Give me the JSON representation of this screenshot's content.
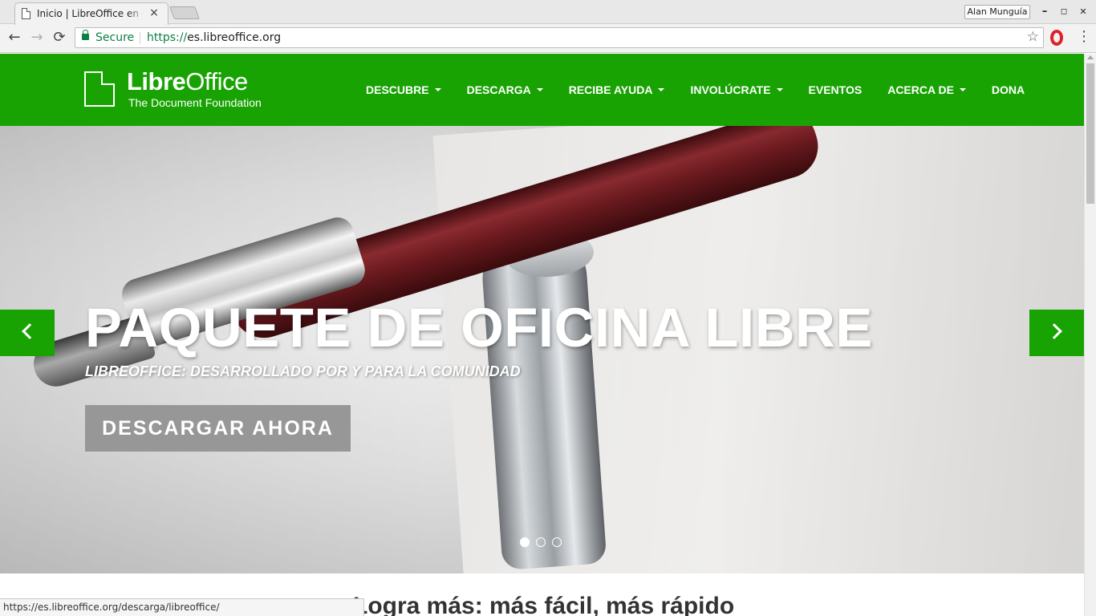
{
  "browser": {
    "tab_title": "Inicio | LibreOffice en español",
    "tab_close": "×",
    "profile_name": "Alan Munguía",
    "window_buttons": {
      "minimize": "–",
      "maximize": "◻",
      "close": "✕"
    },
    "nav": {
      "back": "←",
      "forward": "→",
      "reload": "⟳"
    },
    "security_label": "Secure",
    "url_scheme": "https://",
    "url_host": "es.libreoffice.org",
    "bookmark_icon": "☆",
    "menu_icon": "⋮",
    "status_url": "https://es.libreoffice.org/descarga/libreoffice/"
  },
  "site": {
    "logo": {
      "name_bold": "Libre",
      "name_regular": "Office",
      "tagline": "The Document Foundation"
    },
    "nav": [
      {
        "label": "DESCUBRE",
        "dropdown": true
      },
      {
        "label": "DESCARGA",
        "dropdown": true
      },
      {
        "label": "RECIBE AYUDA",
        "dropdown": true
      },
      {
        "label": "INVOLÚCRATE",
        "dropdown": true
      },
      {
        "label": "EVENTOS",
        "dropdown": false
      },
      {
        "label": "ACERCA DE",
        "dropdown": true
      },
      {
        "label": "DONA",
        "dropdown": false
      }
    ],
    "hero": {
      "title": "PAQUETE DE OFICINA LIBRE",
      "subtitle": "LIBREOFFICE: DESARROLLADO POR Y PARA LA COMUNIDAD",
      "cta": "DESCARGAR AHORA",
      "slides": 3,
      "active_slide": 0
    },
    "intro_heading": "Logra más: más fácil, más rápido"
  },
  "colors": {
    "brand_green": "#18a303",
    "secure_green": "#0b8043",
    "cta_gray": "#979797"
  }
}
